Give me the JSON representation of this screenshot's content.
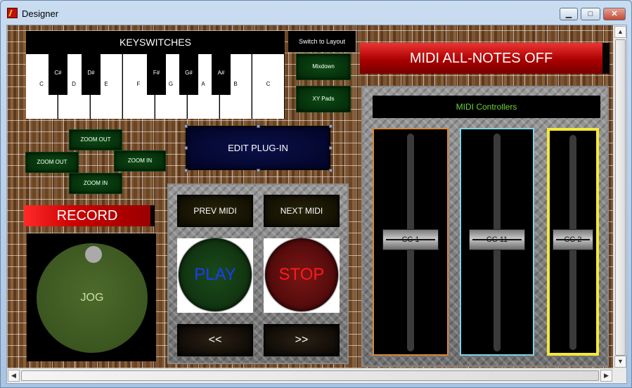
{
  "window": {
    "title": "Designer",
    "minimize_glyph": "▁",
    "maximize_glyph": "□",
    "close_glyph": "✕"
  },
  "keyswitches": {
    "title": "KEYSWITCHES",
    "white_keys": [
      "C",
      "D",
      "E",
      "F",
      "G",
      "A",
      "B",
      "C"
    ],
    "black_keys": [
      "C#",
      "D#",
      "F#",
      "G#",
      "A#"
    ]
  },
  "zoom": {
    "zoom_out_top": "ZOOM OUT",
    "zoom_out_left": "ZOOM OUT",
    "zoom_in_right": "ZOOM IN",
    "zoom_in_bottom": "ZOOM IN"
  },
  "layout_switch": {
    "label": "Switch to Layout",
    "mixdown": "Mixdown",
    "xy_pads": "XY Pads"
  },
  "edit_plugin": "EDIT PLUG-IN",
  "record": "RECORD",
  "jog": "JOG",
  "transport": {
    "prev_midi": "PREV MIDI",
    "next_midi": "NEXT MIDI",
    "play": "PLAY",
    "stop": "STOP",
    "rewind": "<<",
    "forward": ">>"
  },
  "midi_all_notes_off": "MIDI ALL-NOTES OFF",
  "midi_controllers": {
    "title": "MIDI Controllers",
    "faders": [
      {
        "label": "CC 1",
        "border_color": "#d8883a"
      },
      {
        "label": "CC 11",
        "border_color": "#7fd4e8"
      },
      {
        "label": "CC 2",
        "border_color": "#f4e83a"
      }
    ]
  },
  "colors": {
    "play_text": "#1a3cff",
    "stop_text": "#ff1a1a",
    "controllers_title": "#6fd13a"
  },
  "scrollbars": {
    "up": "▲",
    "down": "▼",
    "left": "◀",
    "right": "▶"
  }
}
